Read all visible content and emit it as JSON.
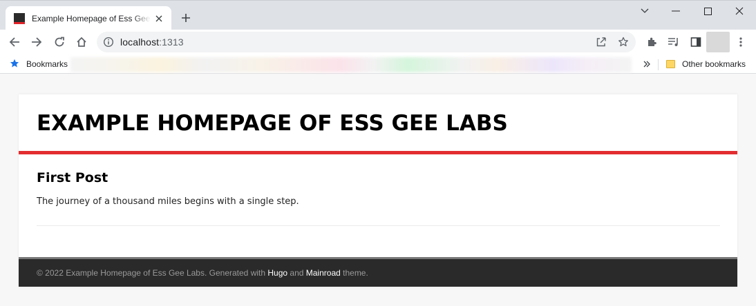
{
  "browser": {
    "tab_title": "Example Homepage of Ess Gee Labs",
    "url_host": "localhost",
    "url_port": ":1313",
    "bookmarks_label": "Bookmarks",
    "other_bookmarks_label": "Other bookmarks",
    "icons": [
      "tab-close-icon",
      "new-tab-icon",
      "minimize-icon",
      "maximize-icon",
      "close-window-icon",
      "chevron-down-icon",
      "back-icon",
      "forward-icon",
      "reload-icon",
      "home-icon",
      "info-icon",
      "share-icon",
      "bookmark-star-icon",
      "extensions-icon",
      "media-control-icon",
      "side-panel-icon",
      "menu-icon",
      "folder-icon"
    ]
  },
  "page": {
    "site_title": "EXAMPLE HOMEPAGE OF ESS GEE LABS",
    "posts": [
      {
        "title": "First Post",
        "summary": "The journey of a thousand miles begins with a single step."
      }
    ],
    "footer": {
      "prefix": "© 2022 Example Homepage of Ess Gee Labs. Generated with ",
      "hugo_link": "Hugo",
      "and_text": " and ",
      "mainroad_link": "Mainroad",
      "suffix": " theme."
    }
  },
  "colors": {
    "accent": "#e22d30",
    "footer_bg": "#2a2a2a",
    "page_bg": "#f7f7f7"
  }
}
